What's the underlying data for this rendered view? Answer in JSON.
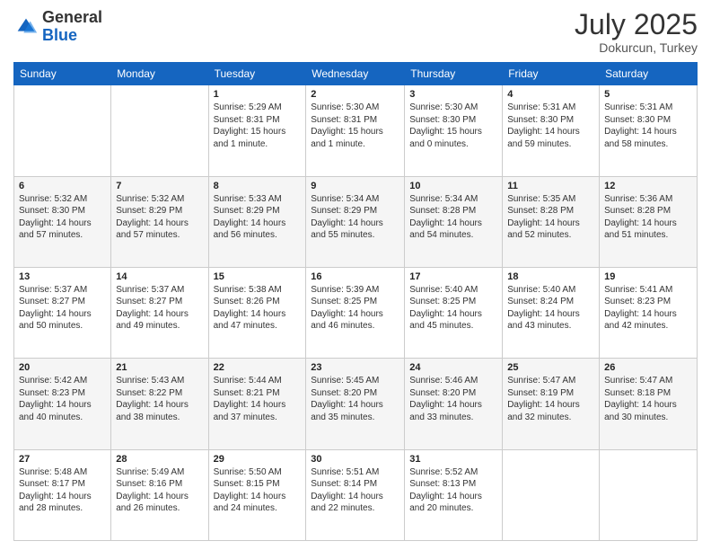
{
  "logo": {
    "general": "General",
    "blue": "Blue"
  },
  "header": {
    "month": "July 2025",
    "location": "Dokurcun, Turkey"
  },
  "weekdays": [
    "Sunday",
    "Monday",
    "Tuesday",
    "Wednesday",
    "Thursday",
    "Friday",
    "Saturday"
  ],
  "weeks": [
    [
      null,
      null,
      {
        "day": "1",
        "sunrise": "5:29 AM",
        "sunset": "8:31 PM",
        "daylight": "15 hours and 1 minute."
      },
      {
        "day": "2",
        "sunrise": "5:30 AM",
        "sunset": "8:31 PM",
        "daylight": "15 hours and 1 minute."
      },
      {
        "day": "3",
        "sunrise": "5:30 AM",
        "sunset": "8:30 PM",
        "daylight": "15 hours and 0 minutes."
      },
      {
        "day": "4",
        "sunrise": "5:31 AM",
        "sunset": "8:30 PM",
        "daylight": "14 hours and 59 minutes."
      },
      {
        "day": "5",
        "sunrise": "5:31 AM",
        "sunset": "8:30 PM",
        "daylight": "14 hours and 58 minutes."
      }
    ],
    [
      {
        "day": "6",
        "sunrise": "5:32 AM",
        "sunset": "8:30 PM",
        "daylight": "14 hours and 57 minutes."
      },
      {
        "day": "7",
        "sunrise": "5:32 AM",
        "sunset": "8:29 PM",
        "daylight": "14 hours and 57 minutes."
      },
      {
        "day": "8",
        "sunrise": "5:33 AM",
        "sunset": "8:29 PM",
        "daylight": "14 hours and 56 minutes."
      },
      {
        "day": "9",
        "sunrise": "5:34 AM",
        "sunset": "8:29 PM",
        "daylight": "14 hours and 55 minutes."
      },
      {
        "day": "10",
        "sunrise": "5:34 AM",
        "sunset": "8:28 PM",
        "daylight": "14 hours and 54 minutes."
      },
      {
        "day": "11",
        "sunrise": "5:35 AM",
        "sunset": "8:28 PM",
        "daylight": "14 hours and 52 minutes."
      },
      {
        "day": "12",
        "sunrise": "5:36 AM",
        "sunset": "8:28 PM",
        "daylight": "14 hours and 51 minutes."
      }
    ],
    [
      {
        "day": "13",
        "sunrise": "5:37 AM",
        "sunset": "8:27 PM",
        "daylight": "14 hours and 50 minutes."
      },
      {
        "day": "14",
        "sunrise": "5:37 AM",
        "sunset": "8:27 PM",
        "daylight": "14 hours and 49 minutes."
      },
      {
        "day": "15",
        "sunrise": "5:38 AM",
        "sunset": "8:26 PM",
        "daylight": "14 hours and 47 minutes."
      },
      {
        "day": "16",
        "sunrise": "5:39 AM",
        "sunset": "8:25 PM",
        "daylight": "14 hours and 46 minutes."
      },
      {
        "day": "17",
        "sunrise": "5:40 AM",
        "sunset": "8:25 PM",
        "daylight": "14 hours and 45 minutes."
      },
      {
        "day": "18",
        "sunrise": "5:40 AM",
        "sunset": "8:24 PM",
        "daylight": "14 hours and 43 minutes."
      },
      {
        "day": "19",
        "sunrise": "5:41 AM",
        "sunset": "8:23 PM",
        "daylight": "14 hours and 42 minutes."
      }
    ],
    [
      {
        "day": "20",
        "sunrise": "5:42 AM",
        "sunset": "8:23 PM",
        "daylight": "14 hours and 40 minutes."
      },
      {
        "day": "21",
        "sunrise": "5:43 AM",
        "sunset": "8:22 PM",
        "daylight": "14 hours and 38 minutes."
      },
      {
        "day": "22",
        "sunrise": "5:44 AM",
        "sunset": "8:21 PM",
        "daylight": "14 hours and 37 minutes."
      },
      {
        "day": "23",
        "sunrise": "5:45 AM",
        "sunset": "8:20 PM",
        "daylight": "14 hours and 35 minutes."
      },
      {
        "day": "24",
        "sunrise": "5:46 AM",
        "sunset": "8:20 PM",
        "daylight": "14 hours and 33 minutes."
      },
      {
        "day": "25",
        "sunrise": "5:47 AM",
        "sunset": "8:19 PM",
        "daylight": "14 hours and 32 minutes."
      },
      {
        "day": "26",
        "sunrise": "5:47 AM",
        "sunset": "8:18 PM",
        "daylight": "14 hours and 30 minutes."
      }
    ],
    [
      {
        "day": "27",
        "sunrise": "5:48 AM",
        "sunset": "8:17 PM",
        "daylight": "14 hours and 28 minutes."
      },
      {
        "day": "28",
        "sunrise": "5:49 AM",
        "sunset": "8:16 PM",
        "daylight": "14 hours and 26 minutes."
      },
      {
        "day": "29",
        "sunrise": "5:50 AM",
        "sunset": "8:15 PM",
        "daylight": "14 hours and 24 minutes."
      },
      {
        "day": "30",
        "sunrise": "5:51 AM",
        "sunset": "8:14 PM",
        "daylight": "14 hours and 22 minutes."
      },
      {
        "day": "31",
        "sunrise": "5:52 AM",
        "sunset": "8:13 PM",
        "daylight": "14 hours and 20 minutes."
      },
      null,
      null
    ]
  ],
  "labels": {
    "sunrise": "Sunrise:",
    "sunset": "Sunset:",
    "daylight": "Daylight:"
  }
}
